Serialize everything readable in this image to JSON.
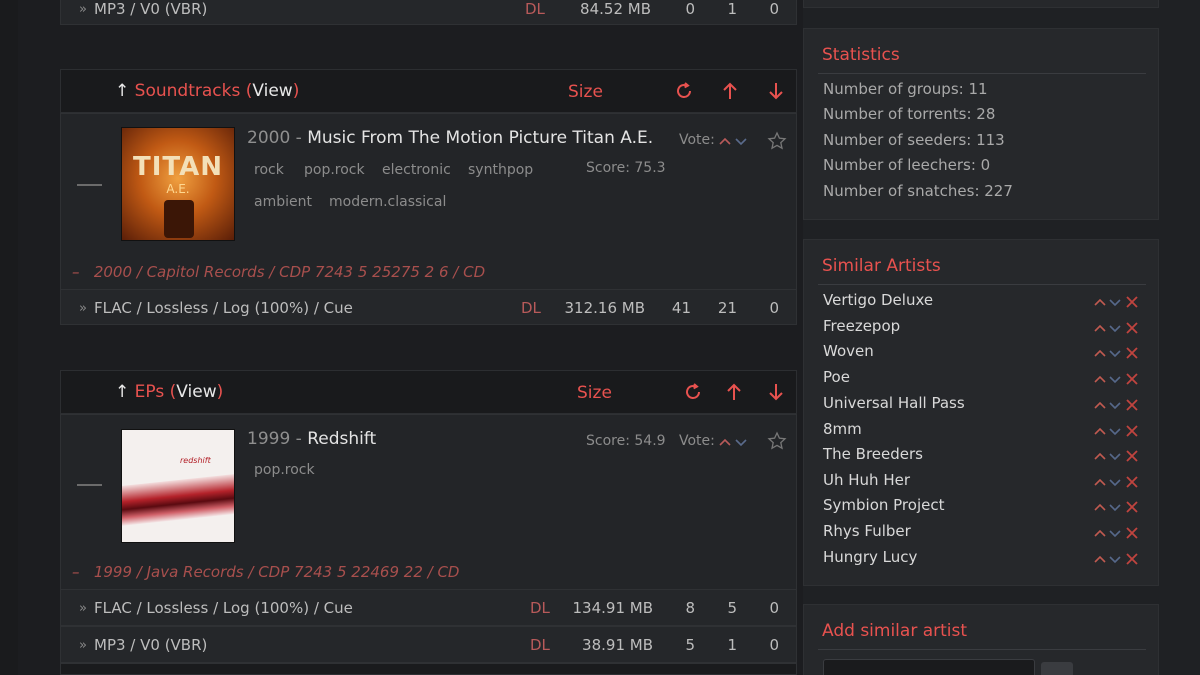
{
  "top_row": {
    "format": "MP3 / V0 (VBR)",
    "dl": "DL",
    "size": "84.52 MB",
    "snatches": "0",
    "seeders": "1",
    "leechers": "0"
  },
  "soundtracks": {
    "header": {
      "up_glyph": "↑",
      "label": "Soundtracks",
      "open": "(",
      "view": "View",
      "close": ")",
      "size_label": "Size"
    },
    "album": {
      "year": "2000",
      "sep": " - ",
      "title": "Music From The Motion Picture Titan A.E.",
      "tags": [
        "rock",
        "pop.rock",
        "electronic",
        "synthpop",
        "ambient",
        "modern.classical"
      ],
      "vote_label": "Vote:",
      "score": "Score: 75.3",
      "edition": "2000 / Capitol Records / CDP 7243 5 25275 2 6 / CD",
      "cover_text": "TITAN",
      "cover_sub": "A.E."
    },
    "torrents": [
      {
        "format": "FLAC / Lossless / Log (100%) / Cue",
        "dl": "DL",
        "size": "312.16 MB",
        "snatches": "41",
        "seeders": "21",
        "leechers": "0"
      }
    ]
  },
  "eps": {
    "header": {
      "up_glyph": "↑",
      "label": "EPs",
      "open": "(",
      "view": "View",
      "close": ")",
      "size_label": "Size"
    },
    "album": {
      "year": "1999",
      "sep": " - ",
      "title": "Redshift",
      "tags": [
        "pop.rock"
      ],
      "vote_label": "Vote:",
      "score": "Score: 54.9",
      "edition": "1999 / Java Records / CDP 7243 5 22469 22 / CD",
      "cover_text": "redshift"
    },
    "torrents": [
      {
        "format": "FLAC / Lossless / Log (100%) / Cue",
        "dl": "DL",
        "size": "134.91 MB",
        "snatches": "8",
        "seeders": "5",
        "leechers": "0"
      },
      {
        "format": "MP3 / V0 (VBR)",
        "dl": "DL",
        "size": "38.91 MB",
        "snatches": "5",
        "seeders": "1",
        "leechers": "0"
      }
    ]
  },
  "statistics": {
    "title": "Statistics",
    "lines": [
      "Number of groups: 11",
      "Number of torrents: 28",
      "Number of seeders: 113",
      "Number of leechers: 0",
      "Number of snatches: 227"
    ]
  },
  "similar": {
    "title": "Similar Artists",
    "artists": [
      "Vertigo Deluxe",
      "Freezepop",
      "Woven",
      "Poe",
      "Universal Hall Pass",
      "8mm",
      "The Breeders",
      "Uh Huh Her",
      "Symbion Project",
      "Rhys Fulber",
      "Hungry Lucy"
    ]
  },
  "add_similar": {
    "title": "Add similar artist"
  },
  "bullet": "»",
  "edition_dash": "–",
  "colors": {
    "accent": "#e8524f",
    "bg": "#1f2124",
    "panel": "#25272a"
  }
}
